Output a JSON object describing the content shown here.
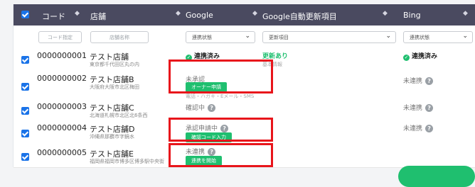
{
  "header": {
    "code": "コード",
    "store": "店舗",
    "google": "Google",
    "google_auto": "Google自動更新項目",
    "bing": "Bing",
    "sort_icon": "◆"
  },
  "filters": {
    "code_placeholder": "コード指定",
    "store_placeholder": "店舗名称",
    "google_select": "連携状態",
    "auto_select": "更新項目",
    "bing_select": "連携状態"
  },
  "rows": [
    {
      "code": "0000000001",
      "name": "テスト店舗",
      "address": "東京都千代田区丸の内",
      "google": "連携済み",
      "auto": "更新あり",
      "auto_sub": "基本情報",
      "bing": "連携済み"
    },
    {
      "code": "0000000002",
      "name": "テスト店舗B",
      "address": "大阪府大阪市北区梅田",
      "google": "未承認",
      "google_button": "オーナー申請",
      "google_sub": "電話・ハガキ・Eメール・SMS",
      "bing": "未連携"
    },
    {
      "code": "0000000003",
      "name": "テスト店舗C",
      "address": "北海道札幌市北区北6条西",
      "google": "確認中",
      "bing": "未連携"
    },
    {
      "code": "0000000004",
      "name": "テスト店舗D",
      "address": "沖縄県那覇市字鏡水",
      "google": "承認申請中",
      "google_button": "確認コード入力",
      "bing": "未連携"
    },
    {
      "code": "0000000005",
      "name": "テスト店舗E",
      "address": "福岡県福岡市博多区博多駅中央街",
      "google": "未連携",
      "google_button": "連携を開始"
    }
  ],
  "colors": {
    "header_bg": "#4a4a60",
    "accent_green": "#1fbf6f",
    "highlight_red": "#e8151b",
    "checkbox_blue": "#1a73e8"
  }
}
